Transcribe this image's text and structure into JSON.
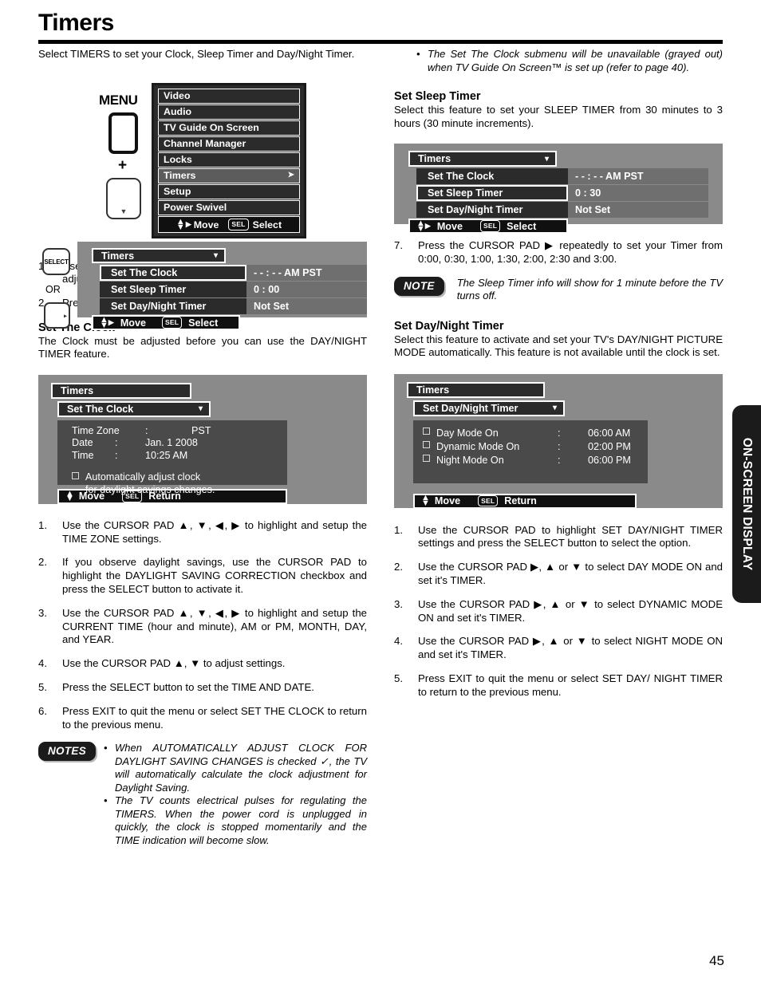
{
  "page": {
    "title": "Timers",
    "number": "45",
    "side_tab": "ON-SCREEN DISPLAY"
  },
  "left": {
    "intro": "Select TIMERS to set your Clock, Sleep Timer and Day/Night Timer.",
    "remote": {
      "menu_label": "MENU",
      "plus": "+",
      "down_caret": "▼",
      "select_label": "SELECT",
      "or_label": "OR",
      "right_caret": "▸"
    },
    "main_menu": {
      "items": [
        {
          "label": "Video",
          "arrow": "",
          "selected": false
        },
        {
          "label": "Audio",
          "arrow": "",
          "selected": false
        },
        {
          "label": "TV Guide On Screen",
          "arrow": "",
          "selected": false
        },
        {
          "label": "Channel Manager",
          "arrow": "",
          "selected": false
        },
        {
          "label": "Locks",
          "arrow": "",
          "selected": false
        },
        {
          "label": "Timers",
          "arrow": "➤",
          "selected": true
        },
        {
          "label": "Setup",
          "arrow": "",
          "selected": false
        },
        {
          "label": "Power Swivel",
          "arrow": "",
          "selected": false
        }
      ],
      "footer_move": "Move",
      "footer_sel_key": "SEL",
      "footer_select": "Select"
    },
    "timers_menu": {
      "header": "Timers",
      "header_caret": "▾",
      "rows": [
        {
          "label": "Set The Clock",
          "value": "- - : - - AM PST",
          "highlighted": true
        },
        {
          "label": "Set Sleep Timer",
          "value": "0 : 00",
          "highlighted": false
        },
        {
          "label": "Set Day/Night Timer",
          "value": "Not Set",
          "highlighted": false
        }
      ],
      "footer_move": "Move",
      "footer_sel_key": "SEL",
      "footer_action": "Select"
    },
    "steps_1": [
      {
        "num": "1.",
        "text": "Use the CURSOR buttons ▲ or ▼ to highlight the function to be adjusted."
      },
      {
        "num": "2.",
        "text": "Press the SELECT button to select."
      }
    ],
    "set_clock_heading": "Set The Clock",
    "set_clock_intro": "The Clock must be adjusted before you can use the DAY/NIGHT TIMER feature.",
    "clock_panel": {
      "header": "Timers",
      "submenu": "Set The Clock",
      "submenu_caret": "▾",
      "fields": [
        {
          "label": "Time Zone",
          "sep": ":",
          "value": "PST"
        },
        {
          "label": "Date",
          "sep": ":",
          "value": "Jan. 1 2008"
        },
        {
          "label": "Time",
          "sep": ":",
          "value": "10:25 AM"
        }
      ],
      "checkbox_line1": "Automatically adjust clock",
      "checkbox_line2": "for daylight savings changes.",
      "footer_move": "Move",
      "footer_sel_key": "SEL",
      "footer_action": "Return"
    },
    "steps_2": [
      {
        "num": "1.",
        "text": "Use the CURSOR PAD ▲, ▼, ◀, ▶ to highlight and setup the TIME ZONE settings."
      },
      {
        "num": "2.",
        "text": "If you observe daylight savings, use the CURSOR PAD to highlight the DAYLIGHT SAVING CORRECTION checkbox and press the SELECT button to activate it."
      },
      {
        "num": "3.",
        "text": "Use the CURSOR PAD ▲, ▼, ◀, ▶ to highlight and setup the CURRENT TIME (hour and minute), AM or PM, MONTH, DAY, and YEAR."
      },
      {
        "num": "4.",
        "text": "Use the CURSOR PAD ▲, ▼ to adjust settings."
      },
      {
        "num": "5.",
        "text": "Press the SELECT button to set the TIME AND DATE."
      },
      {
        "num": "6.",
        "text": "Press EXIT to quit the menu or select SET THE CLOCK to return to the previous menu."
      }
    ],
    "notes_badge": "NOTES",
    "notes": [
      "When AUTOMATICALLY ADJUST CLOCK FOR DAYLIGHT SAVING CHANGES is checked ✓, the TV will automatically calculate the clock adjustment for Daylight Saving.",
      "The TV counts electrical pulses for regulating the TIMERS. When the power cord is unplugged in quickly, the clock is stopped momentarily and the TIME indication will become slow."
    ]
  },
  "right": {
    "top_note": "The Set The Clock submenu will be unavailable (grayed out) when TV Guide On Screen™ is set up (refer to page 40).",
    "sleep_heading": "Set Sleep Timer",
    "sleep_intro": "Select this feature to set your SLEEP TIMER from 30 minutes to 3 hours (30 minute increments).",
    "sleep_panel": {
      "header": "Timers",
      "header_caret": "▾",
      "rows": [
        {
          "label": "Set The Clock",
          "value": "- - : - - AM PST",
          "highlighted": false
        },
        {
          "label": "Set Sleep Timer",
          "value": "0 : 30",
          "highlighted": true
        },
        {
          "label": "Set Day/Night Timer",
          "value": "Not Set",
          "highlighted": false
        }
      ],
      "footer_move": "Move",
      "footer_sel_key": "SEL",
      "footer_action": "Select"
    },
    "step_7": {
      "num": "7.",
      "text": "Press the CURSOR PAD ▶ repeatedly to set your Timer from 0:00, 0:30, 1:00, 1:30, 2:00, 2:30 and 3:00."
    },
    "note_badge": "NOTE",
    "note_text": "The Sleep Timer info will show for 1 minute before the TV turns off.",
    "daynight_heading": "Set Day/Night Timer",
    "daynight_intro": "Select this feature to activate and set your TV's DAY/NIGHT PICTURE MODE automatically. This feature is not available until the clock is set.",
    "daynight_panel": {
      "header": "Timers",
      "submenu": "Set Day/Night Timer",
      "submenu_caret": "▾",
      "rows": [
        {
          "label": "Day  Mode On",
          "sep": ":",
          "value": "06:00 AM"
        },
        {
          "label": "Dynamic Mode On",
          "sep": ":",
          "value": "02:00 PM"
        },
        {
          "label": "Night Mode On",
          "sep": ":",
          "value": "06:00 PM"
        }
      ],
      "footer_move": "Move",
      "footer_sel_key": "SEL",
      "footer_action": "Return"
    },
    "steps": [
      {
        "num": "1.",
        "text": "Use the CURSOR PAD to highlight SET DAY/NIGHT TIMER settings and press the SELECT button to select the option."
      },
      {
        "num": "2.",
        "text": "Use the CURSOR PAD ▶, ▲ or ▼ to select DAY MODE ON and set it's TIMER."
      },
      {
        "num": "3.",
        "text": "Use the CURSOR PAD ▶, ▲ or ▼ to select DYNAMIC MODE ON and set it's TIMER."
      },
      {
        "num": "4.",
        "text": "Use the CURSOR PAD ▶, ▲ or ▼ to select NIGHT MODE ON and set it's TIMER."
      },
      {
        "num": "5.",
        "text": "Press EXIT to quit the menu or select SET DAY/ NIGHT TIMER to return to the previous menu."
      }
    ]
  }
}
